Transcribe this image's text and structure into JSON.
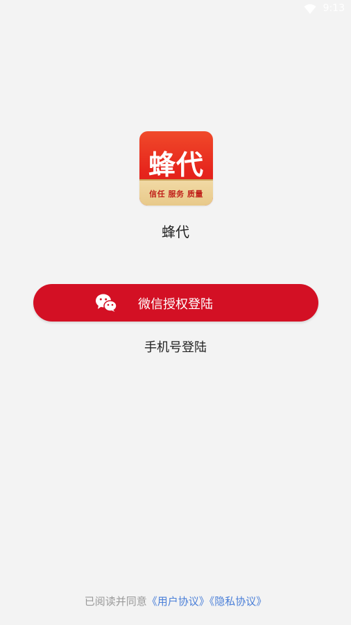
{
  "status_bar": {
    "time": "9:13",
    "wifi_icon": "wifi-icon"
  },
  "app": {
    "logo_text": "蜂代",
    "logo_slogan": "信任 服务 质量",
    "name": "蜂代"
  },
  "login": {
    "wechat_label": "微信授权登陆",
    "wechat_icon": "wechat-icon",
    "phone_label": "手机号登陆"
  },
  "agreement": {
    "prefix": "已阅读并同意",
    "user_agreement": "《用户协议》",
    "privacy_policy": "《隐私协议》"
  },
  "colors": {
    "background": "#f3f3f3",
    "button": "#d31024",
    "link": "#4a7fd8",
    "muted_text": "#9a9a9a"
  }
}
